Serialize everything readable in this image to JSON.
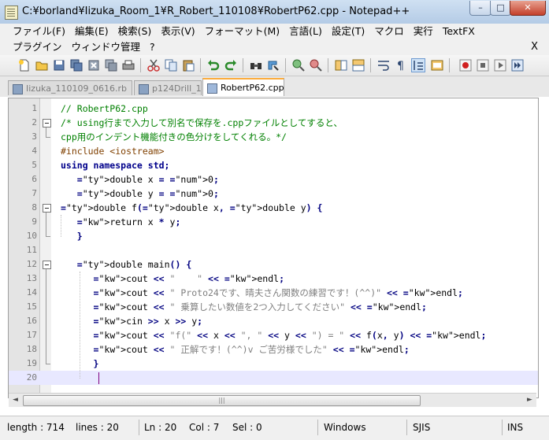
{
  "window": {
    "title": "C:¥borland¥Iizuka_Room_1¥R_Robert_110108¥RobertP62.cpp - Notepad++",
    "min_label": "–",
    "max_label": "□",
    "close_label": "✕"
  },
  "menu": {
    "row1": [
      "ファイル(F)",
      "編集(E)",
      "検索(S)",
      "表示(V)",
      "フォーマット(M)",
      "言語(L)",
      "設定(T)",
      "マクロ",
      "実行",
      "TextFX"
    ],
    "row2": [
      "プラグイン",
      "ウィンドウ管理",
      "?"
    ],
    "close_label": "X"
  },
  "toolbar": {
    "icons": [
      "new-file-icon",
      "open-file-icon",
      "save-icon",
      "save-all-icon",
      "close-icon",
      "close-all-icon",
      "print-icon",
      "cut-icon",
      "copy-icon",
      "paste-icon",
      "undo-icon",
      "redo-icon",
      "find-icon",
      "replace-icon",
      "zoom-in-icon",
      "zoom-out-icon",
      "sync-vertical-icon",
      "sync-horizontal-icon",
      "word-wrap-icon",
      "show-all-characters-icon",
      "indent-guide-icon",
      "user-defined-language-icon",
      "record-macro-icon",
      "stop-recording-icon",
      "playback-macro-icon",
      "run-macro-multiple-icon"
    ]
  },
  "tabs": [
    {
      "label": "Iizuka_110109_0616.rb",
      "active": false
    },
    {
      "label": "p124Drill_1.cpp",
      "active": false
    },
    {
      "label": "RobertP62.cpp",
      "active": true
    }
  ],
  "editor": {
    "lines": [
      {
        "n": "1",
        "text": "// RobertP62.cpp"
      },
      {
        "n": "2",
        "text": "/* using行まで入力して別名で保存を.cppファイルとしてすると、"
      },
      {
        "n": "3",
        "text": "cpp用のインデント機能付きの色分けをしてくれる。*/"
      },
      {
        "n": "4",
        "text": "#include <iostream>"
      },
      {
        "n": "5",
        "text": "using namespace std;"
      },
      {
        "n": "6",
        "text": "   double x = 0;"
      },
      {
        "n": "7",
        "text": "   double y = 0;"
      },
      {
        "n": "8",
        "text": "double f(double x, double y) {"
      },
      {
        "n": "9",
        "text": "   return x * y;"
      },
      {
        "n": "10",
        "text": "   }"
      },
      {
        "n": "11",
        "text": ""
      },
      {
        "n": "12",
        "text": "   double main() {"
      },
      {
        "n": "13",
        "text": "      cout << \"    \" << endl;"
      },
      {
        "n": "14",
        "text": "      cout << \" Proto24です、晴夫さん関数の練習です！(^^)\" << endl;"
      },
      {
        "n": "15",
        "text": "      cout << \" 乗算したい数値を2つ入力してください\" << endl;"
      },
      {
        "n": "16",
        "text": "      cin >> x >> y;"
      },
      {
        "n": "17",
        "text": "      cout << \"f(\" << x << \", \" << y << \") = \" << f(x, y) << endl;"
      },
      {
        "n": "18",
        "text": "      cout << \" 正解です！(^^)v ご苦労様でした\" << endl;"
      },
      {
        "n": "19",
        "text": "      }"
      },
      {
        "n": "20",
        "text": ""
      }
    ]
  },
  "scrollbar": {
    "left_arrow": "◄",
    "right_arrow": "►",
    "grip": "|||"
  },
  "status": {
    "length": "length : 714",
    "lines": "lines : 20",
    "ln": "Ln : 20",
    "col": "Col : 7",
    "sel": "Sel : 0",
    "eol": "Windows",
    "encoding": "SJIS",
    "mode": "INS"
  }
}
